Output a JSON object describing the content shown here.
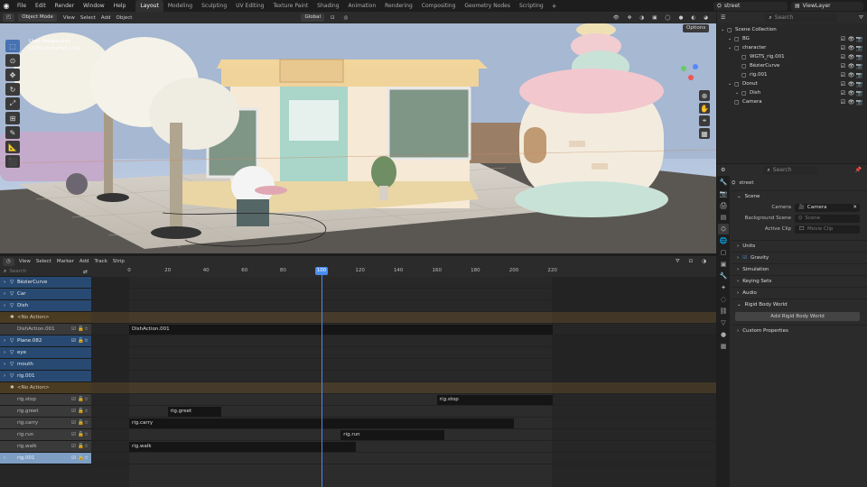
{
  "topbar": {
    "menu": [
      "File",
      "Edit",
      "Render",
      "Window",
      "Help"
    ],
    "tabs": [
      "Layout",
      "Modeling",
      "Sculpting",
      "UV Editing",
      "Texture Paint",
      "Shading",
      "Animation",
      "Rendering",
      "Compositing",
      "Geometry Nodes",
      "Scripting"
    ],
    "active_tab": "Layout",
    "scene": "street",
    "view_layer": "ViewLayer"
  },
  "viewport": {
    "mode": "Object Mode",
    "menu": [
      "View",
      "Select",
      "Add",
      "Object"
    ],
    "transform": "Global",
    "overlay_title": "User Perspective",
    "overlay_sub": "(100) character | Sky",
    "options": "Options"
  },
  "outliner": {
    "search_placeholder": "Search",
    "items": [
      {
        "name": "Scene Collection",
        "indent": 0
      },
      {
        "name": "BG",
        "indent": 1
      },
      {
        "name": "character",
        "indent": 1
      },
      {
        "name": "WGTS_rig.001",
        "indent": 2
      },
      {
        "name": "BézierCurve",
        "indent": 2
      },
      {
        "name": "rig.001",
        "indent": 2
      },
      {
        "name": "Donut",
        "indent": 1
      },
      {
        "name": "Dish",
        "indent": 2
      },
      {
        "name": "Camera",
        "indent": 1
      }
    ]
  },
  "properties": {
    "search_placeholder": "Search",
    "scene_name": "street",
    "section_scene": "Scene",
    "camera_label": "Camera",
    "camera_value": "Camera",
    "bg_label": "Background Scene",
    "bg_value": "Scene",
    "clip_label": "Active Clip",
    "clip_value": "Movie Clip",
    "sections": [
      "Units",
      "Gravity",
      "Simulation",
      "Keying Sets",
      "Audio",
      "Rigid Body World"
    ],
    "add_rbw": "Add Rigid Body World",
    "custom": "Custom Properties"
  },
  "nla": {
    "menu": [
      "View",
      "Select",
      "Marker",
      "Add",
      "Track",
      "Strip"
    ],
    "search_placeholder": "Search",
    "current_frame": "100",
    "ruler": [
      "0",
      "20",
      "40",
      "60",
      "80",
      "100",
      "120",
      "140",
      "160",
      "180",
      "200",
      "220"
    ],
    "tracks": [
      {
        "name": "BézierCurve",
        "kind": "blue"
      },
      {
        "name": "Car",
        "kind": "blue"
      },
      {
        "name": "Dish",
        "kind": "blue"
      },
      {
        "name": "<No Action>",
        "kind": "orange"
      },
      {
        "name": "DishAction.001",
        "kind": "gray"
      },
      {
        "name": "Plane.082",
        "kind": "blue"
      },
      {
        "name": "eye",
        "kind": "blue"
      },
      {
        "name": "mouth",
        "kind": "blue"
      },
      {
        "name": "rig.001",
        "kind": "blue"
      },
      {
        "name": "<No Action>",
        "kind": "orange"
      },
      {
        "name": "rig.stop",
        "kind": "gray"
      },
      {
        "name": "rig.greet",
        "kind": "gray"
      },
      {
        "name": "rig.carry",
        "kind": "gray"
      },
      {
        "name": "rig.run",
        "kind": "gray"
      },
      {
        "name": "rig.walk",
        "kind": "gray"
      },
      {
        "name": "rig.001",
        "kind": "sel"
      }
    ],
    "strips": [
      {
        "name": "DishAction.001",
        "row": 4,
        "start": 0,
        "end": 220
      },
      {
        "name": "rig.stop",
        "row": 10,
        "start": 160,
        "end": 220
      },
      {
        "name": "rig.greet",
        "row": 11,
        "start": 20,
        "end": 48
      },
      {
        "name": "rig.carry",
        "row": 12,
        "start": 0,
        "end": 200
      },
      {
        "name": "rig.run",
        "row": 13,
        "start": 110,
        "end": 164
      },
      {
        "name": "rig.walk",
        "row": 14,
        "start": 0,
        "end": 118
      }
    ]
  }
}
